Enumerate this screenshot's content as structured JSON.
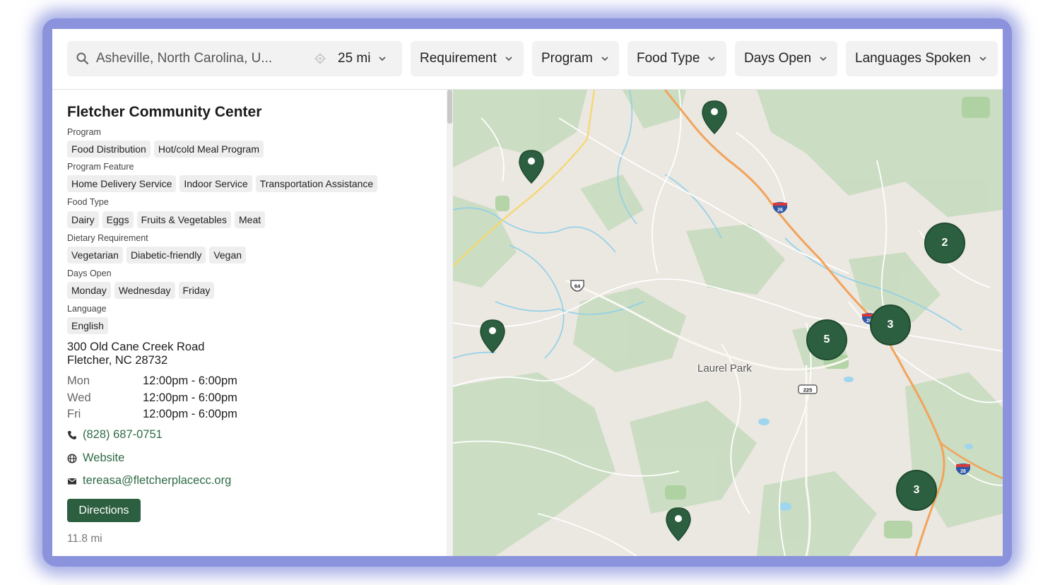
{
  "filters": {
    "search": {
      "value": "Asheville, North Carolina, U...",
      "radius": "25 mi"
    },
    "requirement": "Requirement",
    "program": "Program",
    "food_type": "Food Type",
    "days_open": "Days Open",
    "languages": "Languages Spoken"
  },
  "detail": {
    "title": "Fletcher Community Center",
    "sections": [
      {
        "label": "Program",
        "tags": [
          "Food Distribution",
          "Hot/cold Meal Program"
        ]
      },
      {
        "label": "Program Feature",
        "tags": [
          "Home Delivery Service",
          "Indoor Service",
          "Transportation Assistance"
        ]
      },
      {
        "label": "Food Type",
        "tags": [
          "Dairy",
          "Eggs",
          "Fruits & Vegetables",
          "Meat"
        ]
      },
      {
        "label": "Dietary Requirement",
        "tags": [
          "Vegetarian",
          "Diabetic-friendly",
          "Vegan"
        ]
      },
      {
        "label": "Days Open",
        "tags": [
          "Monday",
          "Wednesday",
          "Friday"
        ]
      },
      {
        "label": "Language",
        "tags": [
          "English"
        ]
      }
    ],
    "address_line1": "300 Old Cane Creek Road",
    "address_line2": "Fletcher, NC 28732",
    "hours": [
      {
        "day": "Mon",
        "time": "12:00pm - 6:00pm"
      },
      {
        "day": "Wed",
        "time": "12:00pm - 6:00pm"
      },
      {
        "day": "Fri",
        "time": "12:00pm - 6:00pm"
      }
    ],
    "phone": "(828) 687-0751",
    "website": "Website",
    "email": "tereasa@fletcherplacecc.org",
    "directions_label": "Directions",
    "distance": "11.8 mi"
  },
  "map": {
    "place": "Laurel Park",
    "clusters": [
      "2",
      "3",
      "5",
      "3"
    ],
    "shields": [
      "26",
      "26",
      "26",
      "64",
      "225"
    ],
    "accent": "#2c5f3f"
  }
}
